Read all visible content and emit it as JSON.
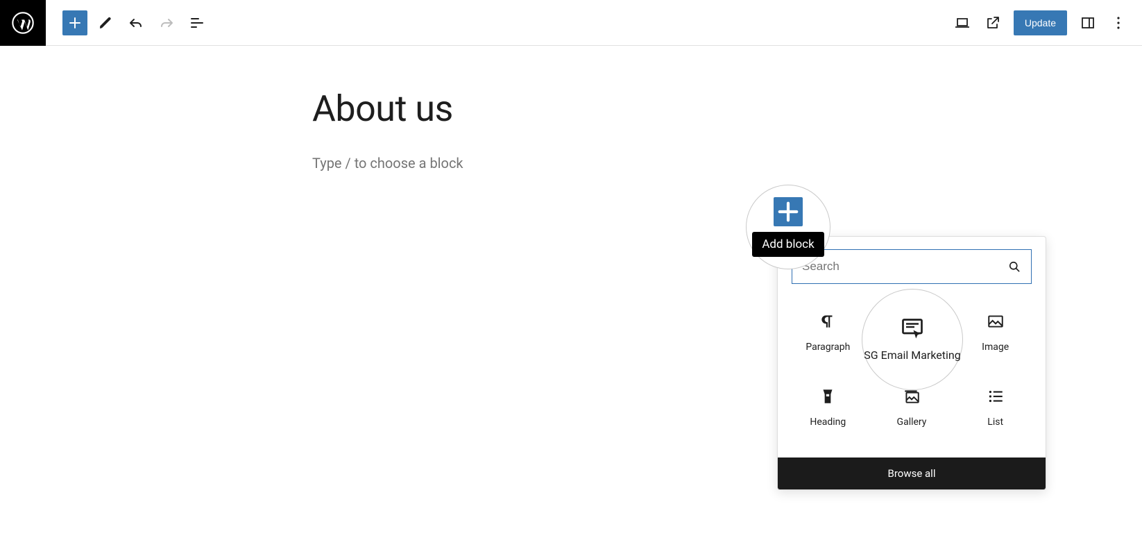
{
  "toolbar": {
    "update_label": "Update",
    "add_block_tooltip": "Add block"
  },
  "page": {
    "title": "About us",
    "prompt": "Type / to choose a block"
  },
  "inserter": {
    "search_placeholder": "Search",
    "browse_all": "Browse all",
    "blocks": [
      {
        "id": "paragraph",
        "label": "Paragraph"
      },
      {
        "id": "sg-email",
        "label": "SG Email Marketing"
      },
      {
        "id": "image",
        "label": "Image"
      },
      {
        "id": "heading",
        "label": "Heading"
      },
      {
        "id": "gallery",
        "label": "Gallery"
      },
      {
        "id": "list",
        "label": "List"
      }
    ]
  },
  "highlight": {
    "block_label": "SG Email\nMarketing"
  }
}
